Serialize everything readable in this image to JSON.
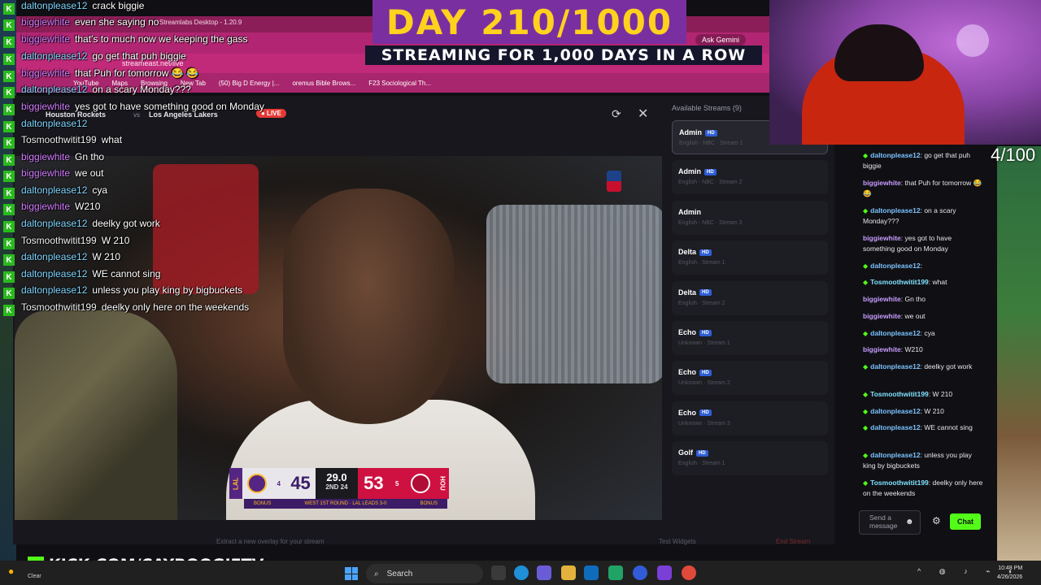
{
  "browser": {
    "streamlabs_title": "Streamlabs Desktop - 1.20.9",
    "url": "streameast.net/live",
    "ask_gemini": "Ask Gemini",
    "bookmarks": [
      "YouTube",
      "Maps",
      "Browsing",
      "New Tab",
      "(50) Big D Energy |...",
      "oremus Bible Brows...",
      "F23 Sociological Th..."
    ]
  },
  "overlay": {
    "day_banner": "DAY 210/1000",
    "day_subtitle": "STREAMING FOR 1,000 DAYS IN A ROW",
    "counter": "4/100",
    "brand": "KICK.COM/CAYBOOGIETV",
    "brand_k": "K"
  },
  "overlay_chat": [
    {
      "user": "daltonplease12",
      "msg": "crack biggie",
      "color": "blue"
    },
    {
      "user": "biggiewhite",
      "msg": "even she saying no",
      "color": "purple"
    },
    {
      "user": "biggiewhite",
      "msg": "that's to much now we keeping the gass",
      "color": "purple"
    },
    {
      "user": "daltonplease12",
      "msg": "go get that puh biggie",
      "color": "blue"
    },
    {
      "user": "biggiewhite",
      "msg": "that Puh for tomorrow 😂 😂",
      "color": "purple"
    },
    {
      "user": "daltonplease12",
      "msg": "on a scary Monday???",
      "color": "blue"
    },
    {
      "user": "biggiewhite",
      "msg": "yes got to have something good on Monday",
      "color": "purple"
    },
    {
      "user": "daltonplease12",
      "msg": "",
      "color": "blue"
    },
    {
      "user": "Tosmoothwitit199",
      "msg": "what",
      "color": "white"
    },
    {
      "user": "biggiewhite",
      "msg": "Gn tho",
      "color": "purple"
    },
    {
      "user": "biggiewhite",
      "msg": "we out",
      "color": "purple"
    },
    {
      "user": "daltonplease12",
      "msg": "cya",
      "color": "blue"
    },
    {
      "user": "biggiewhite",
      "msg": "W210",
      "color": "purple"
    },
    {
      "user": "daltonplease12",
      "msg": "deelky got work",
      "color": "blue"
    },
    {
      "user": "Tosmoothwitit199",
      "msg": "W 210",
      "color": "white"
    },
    {
      "user": "daltonplease12",
      "msg": "W 210",
      "color": "blue"
    },
    {
      "user": "daltonplease12",
      "msg": "WE cannot sing",
      "color": "blue"
    },
    {
      "user": "daltonplease12",
      "msg": "unless you play king by bigbuckets",
      "color": "blue"
    },
    {
      "user": "Tosmoothwitit199",
      "msg": "deelky only here on the weekends",
      "color": "white"
    }
  ],
  "player": {
    "team_home": "Houston Rockets",
    "vs": "vs",
    "team_away": "Los Angeles Lakers",
    "live": "● LIVE"
  },
  "scoreboard": {
    "away_tag": "LAL",
    "away_score": "45",
    "away_timeouts": "4",
    "clock": "29.0",
    "period": "2ND",
    "shot_clock": "24",
    "home_score": "53",
    "home_timeouts": "5",
    "home_tag": "HOU",
    "footer_left": "BONUS",
    "footer_mid": "WEST 1ST ROUND · LAL LEADS 3-0",
    "footer_right": "BONUS"
  },
  "streams": {
    "title": "Available Streams (9)",
    "hd_label": "HD",
    "items": [
      {
        "name": "Admin",
        "hd": true,
        "sub": "English - NBC · Stream 1",
        "active": true
      },
      {
        "name": "Admin",
        "hd": true,
        "sub": "English - NBC · Stream 2",
        "active": false
      },
      {
        "name": "Admin",
        "hd": false,
        "sub": "English - NBC · Stream 3",
        "active": false
      },
      {
        "name": "Delta",
        "hd": true,
        "sub": "English · Stream 1",
        "active": false
      },
      {
        "name": "Delta",
        "hd": true,
        "sub": "English · Stream 2",
        "active": false
      },
      {
        "name": "Echo",
        "hd": true,
        "sub": "Unknown · Stream 1",
        "active": false
      },
      {
        "name": "Echo",
        "hd": true,
        "sub": "Unknown · Stream 2",
        "active": false
      },
      {
        "name": "Echo",
        "hd": true,
        "sub": "Unknown · Stream 3",
        "active": false
      },
      {
        "name": "Golf",
        "hd": true,
        "sub": "English · Stream 1",
        "active": false
      }
    ]
  },
  "app_bottom": {
    "overlay_hint": "Extract a new overlay for your stream",
    "test_widgets": "Test Widgets",
    "end_stream": "End Stream"
  },
  "side_chat": {
    "messages": [
      {
        "user": "daltonplease12",
        "msg": "go get that puh biggie",
        "kind": "mod"
      },
      {
        "user": "biggiewhite",
        "msg": "that Puh for tomorrow 😂 😂",
        "kind": "plain"
      },
      {
        "user": "daltonplease12",
        "msg": "on a scary Monday???",
        "kind": "mod"
      },
      {
        "user": "biggiewhite",
        "msg": "yes got to have something good on Monday",
        "kind": "plain"
      },
      {
        "user": "daltonplease12",
        "msg": "",
        "kind": "mod"
      },
      {
        "user": "Tosmoothwitit199",
        "msg": "what",
        "kind": "mod"
      },
      {
        "user": "biggiewhite",
        "msg": "Gn tho",
        "kind": "plain"
      },
      {
        "user": "biggiewhite",
        "msg": "we out",
        "kind": "plain"
      },
      {
        "user": "daltonplease12",
        "msg": "cya",
        "kind": "mod"
      },
      {
        "user": "biggiewhite",
        "msg": "W210",
        "kind": "plain"
      },
      {
        "user": "daltonplease12",
        "msg": "deelky got work",
        "kind": "mod"
      },
      {
        "user": "Tosmoothwitit199",
        "msg": "W 210",
        "kind": "mod"
      },
      {
        "user": "daltonplease12",
        "msg": "W 210",
        "kind": "mod"
      },
      {
        "user": "daltonplease12",
        "msg": "WE cannot sing",
        "kind": "mod"
      },
      {
        "user": "daltonplease12",
        "msg": "unless you play king by bigbuckets",
        "kind": "mod"
      },
      {
        "user": "Tosmoothwitit199",
        "msg": "deelky only here on the weekends",
        "kind": "mod"
      }
    ],
    "send_placeholder": "Send a message",
    "chat_button": "Chat"
  },
  "taskbar": {
    "weather": "Clear",
    "search": "Search",
    "time": "10:48 PM",
    "date": "4/26/2026"
  }
}
